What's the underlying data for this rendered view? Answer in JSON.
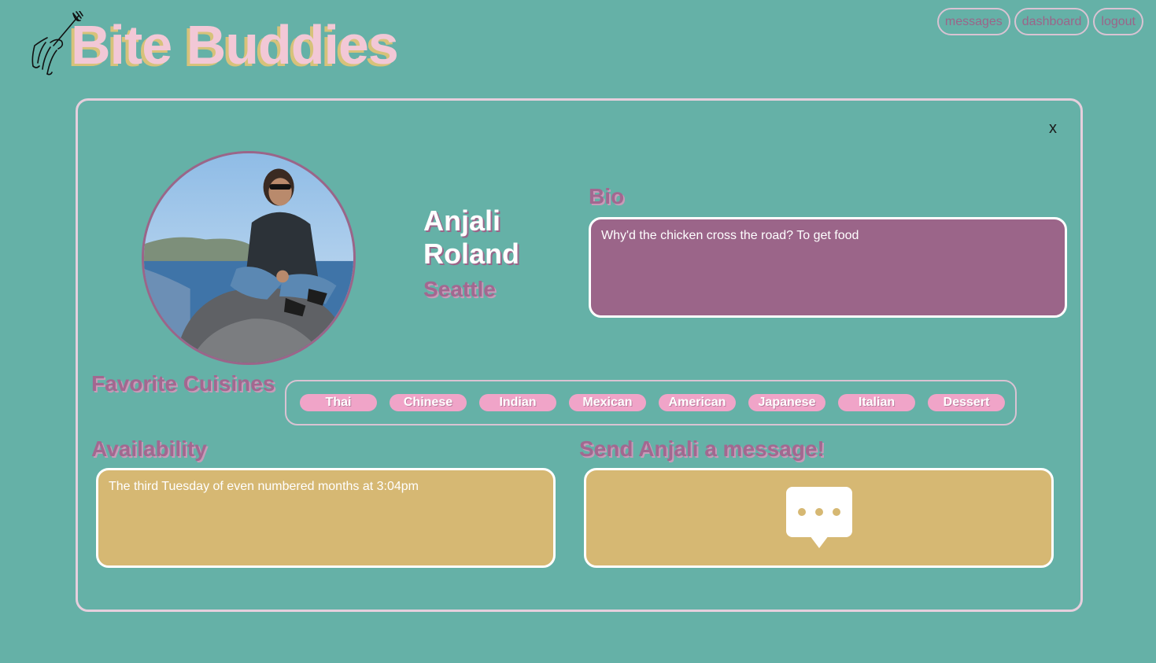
{
  "app": {
    "logo_text": "Bite Buddies"
  },
  "nav": {
    "messages": "messages",
    "dashboard": "dashboard",
    "logout": "logout"
  },
  "profile": {
    "close_label": "x",
    "name": "Anjali Roland",
    "city": "Seattle",
    "bio_heading": "Bio",
    "bio": "Why'd the chicken cross the road? To get food",
    "cuisines_heading": "Favorite Cuisines",
    "cuisines": [
      "Thai",
      "Chinese",
      "Indian",
      "Mexican",
      "American",
      "Japanese",
      "Italian",
      "Dessert"
    ],
    "availability_heading": "Availability",
    "availability": "The third Tuesday of even numbered months at 3:04pm",
    "message_heading": "Send Anjali a message!"
  },
  "colors": {
    "background": "#65b1a7",
    "accent_purple": "#9b6589",
    "accent_pink": "#f0a4c8",
    "accent_gold": "#d6b873",
    "border_light": "#e6cfdd"
  }
}
